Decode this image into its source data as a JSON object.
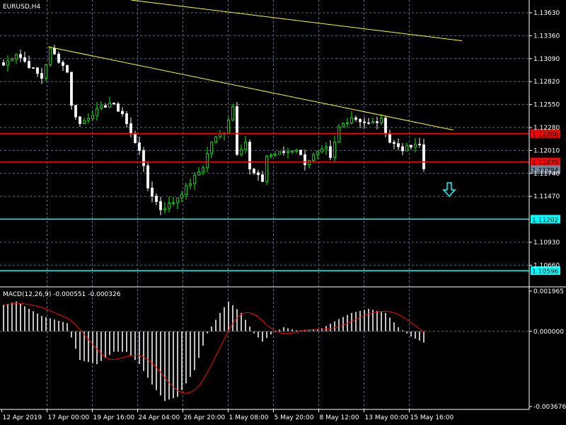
{
  "window": {
    "symbol_label": "EURUSD,H4"
  },
  "chart_data": {
    "type": "candlestick",
    "title": "EURUSD,H4",
    "price_ticks": [
      "1.13630",
      "1.13360",
      "1.13090",
      "1.12820",
      "1.12550",
      "1.12280",
      "1.12010",
      "1.11740",
      "1.11470",
      "1.10930",
      "1.10660"
    ],
    "price_range": [
      1.103,
      1.1378
    ],
    "time_ticks": [
      "12 Apr 2019",
      "17 Apr 00:00",
      "19 Apr 16:00",
      "24 Apr 04:00",
      "26 Apr 20:00",
      "1 May 08:00",
      "5 May 20:00",
      "8 May 12:00",
      "13 May 00:00",
      "15 May 16:00"
    ],
    "bars_per_tick": 10.7,
    "close_keypoints": [
      [
        0,
        1.13013
      ],
      [
        3,
        1.13155
      ],
      [
        9,
        1.12863
      ],
      [
        11,
        1.13197
      ],
      [
        15,
        1.12947
      ],
      [
        16,
        1.1253
      ],
      [
        18,
        1.12322
      ],
      [
        21,
        1.12447
      ],
      [
        25,
        1.12572
      ],
      [
        28,
        1.12447
      ],
      [
        30,
        1.12197
      ],
      [
        32,
        1.1203
      ],
      [
        34,
        1.11572
      ],
      [
        37,
        1.11322
      ],
      [
        40,
        1.11405
      ],
      [
        43,
        1.11572
      ],
      [
        47,
        1.11822
      ],
      [
        49,
        1.12113
      ],
      [
        52,
        1.12238
      ],
      [
        54,
        1.1253
      ],
      [
        55,
        1.11988
      ],
      [
        57,
        1.12113
      ],
      [
        58,
        1.1178
      ],
      [
        61,
        1.11655
      ],
      [
        62,
        1.11947
      ],
      [
        66,
        1.11988
      ],
      [
        69,
        1.1203
      ],
      [
        71,
        1.11863
      ],
      [
        73,
        1.11947
      ],
      [
        76,
        1.1203
      ],
      [
        77,
        1.11905
      ],
      [
        79,
        1.1228
      ],
      [
        82,
        1.12405
      ],
      [
        86,
        1.12322
      ],
      [
        89,
        1.12363
      ],
      [
        91,
        1.12113
      ],
      [
        94,
        1.1203
      ],
      [
        98,
        1.12072
      ],
      [
        99,
        1.11794
      ]
    ],
    "horizontal_levels": [
      {
        "price": "1.12208",
        "color": "#ff0000"
      },
      {
        "price": "1.11875",
        "color": "#ff0000"
      },
      {
        "price": "1.11202",
        "color": "#00ffff"
      },
      {
        "price": "1.10596",
        "color": "#00ffff"
      }
    ],
    "bid_label": "1.11794",
    "trendlines": [
      {
        "from": [
          30,
          1.1378
        ],
        "to": [
          108,
          1.133
        ],
        "color": "#ffff00"
      },
      {
        "from": [
          10.5,
          1.1323
        ],
        "to": [
          106,
          1.1225
        ],
        "color": "#ffff00"
      }
    ],
    "signal_arrow": {
      "bar": 105,
      "price": 1.1148,
      "direction": "down",
      "color": "#00ffff"
    },
    "macd": {
      "label": "MACD(12,26,9) -0.000551 -0.000326",
      "ticks": [
        "0.001965",
        "0.000000",
        "-0.003676"
      ],
      "range": [
        -0.003676,
        0.001965
      ],
      "hist_keypoints": [
        [
          0,
          0.00129
        ],
        [
          3,
          0.00146
        ],
        [
          9,
          0.00075
        ],
        [
          15,
          0.0004
        ],
        [
          16,
          -0.0003
        ],
        [
          18,
          -0.0014
        ],
        [
          22,
          -0.0016
        ],
        [
          26,
          -0.001
        ],
        [
          29,
          -0.001
        ],
        [
          32,
          -0.0016
        ],
        [
          35,
          -0.0026
        ],
        [
          38,
          -0.0034
        ],
        [
          41,
          -0.0032
        ],
        [
          45,
          -0.0019
        ],
        [
          48,
          -0.0001
        ],
        [
          51,
          0.0009
        ],
        [
          53,
          0.00146
        ],
        [
          56,
          0.0009
        ],
        [
          59,
          -0.0001
        ],
        [
          61,
          -0.0005
        ],
        [
          63,
          -0.00015
        ],
        [
          66,
          0.0002
        ],
        [
          69,
          5e-05
        ],
        [
          72,
          5e-05
        ],
        [
          75,
          0.00015
        ],
        [
          79,
          0.0006
        ],
        [
          82,
          0.0009
        ],
        [
          86,
          0.0011
        ],
        [
          90,
          0.0009
        ],
        [
          93,
          0.0002
        ],
        [
          96,
          -0.00025
        ],
        [
          99,
          -0.00055
        ]
      ]
    },
    "colors": {
      "bull": "#00ff00",
      "bear": "#ffffff",
      "grid": "#5a6878",
      "axis": "#ffffff",
      "macd_hist": "#c0c0c0",
      "signal": "#ff0000"
    }
  }
}
